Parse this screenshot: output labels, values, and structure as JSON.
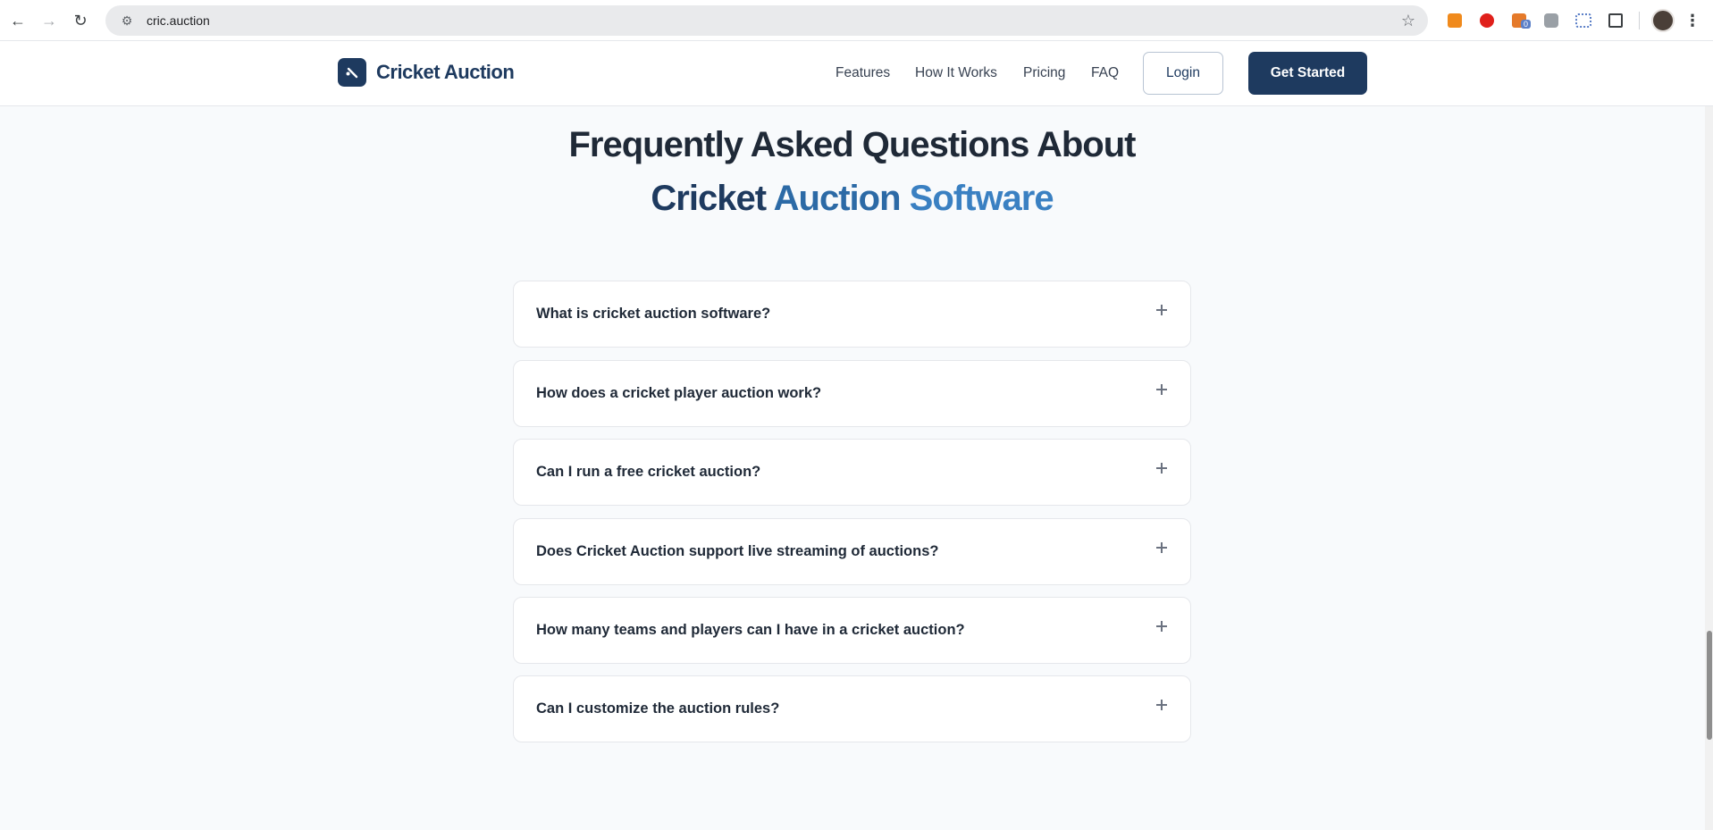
{
  "browser": {
    "url": "cric.auction",
    "back_glyph": "←",
    "forward_glyph": "→",
    "reload_glyph": "↻",
    "site_info_glyph": "⚙",
    "star_glyph": "☆",
    "menu_glyph": "⋮",
    "extensions": [
      {
        "name": "extension-orange",
        "color": "#f08a1c"
      },
      {
        "name": "extension-red",
        "color": "#e0201b"
      },
      {
        "name": "extension-badge",
        "color": "#e57a2a",
        "badge": "0"
      },
      {
        "name": "extension-camera",
        "color": "#9aa0a6"
      },
      {
        "name": "extension-fdi",
        "color": "#5b7fc7"
      },
      {
        "name": "extensions-puzzle",
        "color": "#3c4043"
      }
    ]
  },
  "header": {
    "brand": "Cricket Auction",
    "nav": [
      "Features",
      "How It Works",
      "Pricing",
      "FAQ"
    ],
    "login_label": "Login",
    "cta_label": "Get Started",
    "brand_color": "#1e3a5f"
  },
  "faq_section": {
    "title_line1": "Frequently Asked Questions About",
    "title_line2_parts": [
      "Cricket",
      "Auction",
      "Software"
    ],
    "questions": [
      "What is cricket auction software?",
      "How does a cricket player auction work?",
      "Can I run a free cricket auction?",
      "Does Cricket Auction support live streaming of auctions?",
      "How many teams and players can I have in a cricket auction?",
      "Can I customize the auction rules?"
    ]
  }
}
